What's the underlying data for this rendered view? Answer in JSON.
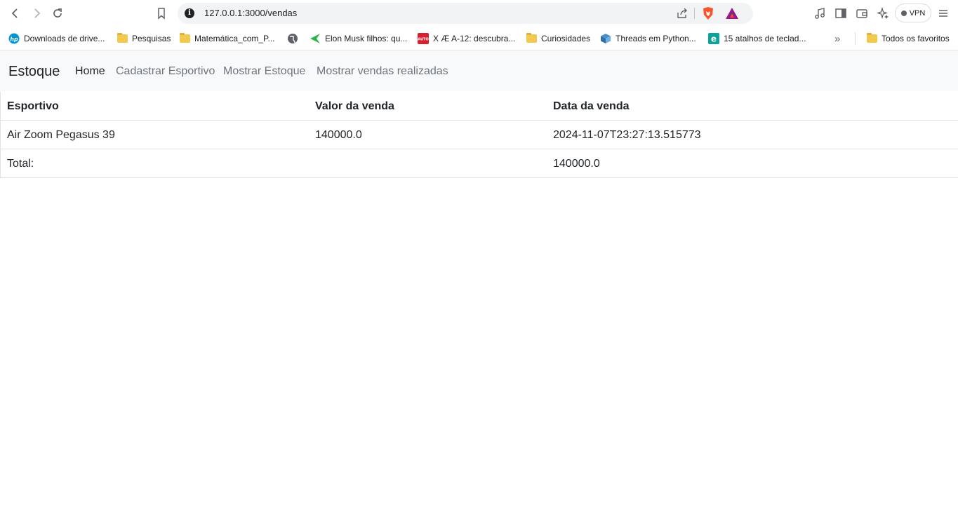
{
  "browser": {
    "url": "127.0.0.1:3000/vendas",
    "vpn_label": "VPN",
    "bookmarks": [
      {
        "label": "Downloads de drive...",
        "icon": "hp-icon"
      },
      {
        "label": "Pesquisas",
        "icon": "folder-icon"
      },
      {
        "label": "Matemática_com_P...",
        "icon": "folder-icon"
      },
      {
        "label": "",
        "icon": "globe-icon"
      },
      {
        "label": "Elon Musk filhos: qu...",
        "icon": "green-arrow-icon"
      },
      {
        "label": "X Æ A-12: descubra...",
        "icon": "auto-icon"
      },
      {
        "label": "Curiosidades",
        "icon": "folder-icon"
      },
      {
        "label": "Threads em Python...",
        "icon": "cube-icon"
      },
      {
        "label": "15 atalhos de teclad...",
        "icon": "e-icon"
      },
      {
        "label": "Todos os favoritos",
        "icon": "folder-icon"
      }
    ],
    "more_label": "»"
  },
  "navbar": {
    "brand": "Estoque",
    "links": [
      "Home",
      "Cadastrar Esportivo",
      "Mostrar Estoque",
      "Mostrar vendas realizadas"
    ]
  },
  "table": {
    "headers": [
      "Esportivo",
      "Valor da venda",
      "Data da venda"
    ],
    "rows": [
      [
        "Air Zoom Pegasus 39",
        "140000.0",
        "2024-11-07T23:27:13.515773"
      ]
    ],
    "total_label": "Total:",
    "total_value": "140000.0"
  }
}
